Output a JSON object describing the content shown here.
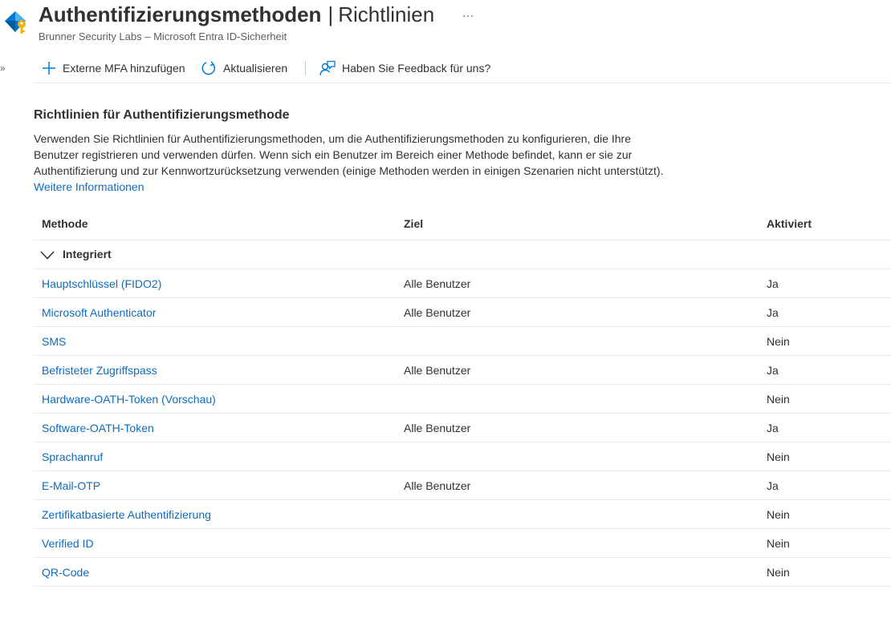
{
  "header": {
    "title": "Authentifizierungsmethoden",
    "title_separator": "|",
    "title_suffix": "Richtlinien",
    "more_icon": "…",
    "subtitle": "Brunner Security Labs – Microsoft Entra ID-Sicherheit"
  },
  "nav": {
    "collapse_icon": "»"
  },
  "toolbar": {
    "add_mfa_label": "Externe MFA hinzufügen",
    "refresh_label": "Aktualisieren",
    "feedback_label": "Haben Sie Feedback für uns?"
  },
  "section": {
    "title": "Richtlinien für Authentifizierungsmethode",
    "description": "Verwenden Sie Richtlinien für Authentifizierungsmethoden, um die Authentifizierungsmethoden zu konfigurieren, die Ihre Benutzer registrieren und verwenden dürfen. Wenn sich ein Benutzer im Bereich einer Methode befindet, kann er sie zur Authentifizierung und zur Kennwortzurücksetzung verwenden (einige Methoden werden in einigen Szenarien nicht unterstützt).",
    "learn_more": "Weitere Informationen"
  },
  "table": {
    "columns": [
      "Methode",
      "Ziel",
      "Aktiviert"
    ],
    "group_label": "Integriert",
    "rows": [
      {
        "method": "Hauptschlüssel (FIDO2)",
        "target": "Alle Benutzer",
        "enabled": "Ja"
      },
      {
        "method": "Microsoft Authenticator",
        "target": "Alle Benutzer",
        "enabled": "Ja"
      },
      {
        "method": "SMS",
        "target": "",
        "enabled": "Nein"
      },
      {
        "method": "Befristeter Zugriffspass",
        "target": "Alle Benutzer",
        "enabled": "Ja"
      },
      {
        "method": "Hardware-OATH-Token (Vorschau)",
        "target": "",
        "enabled": "Nein"
      },
      {
        "method": "Software-OATH-Token",
        "target": "Alle Benutzer",
        "enabled": "Ja"
      },
      {
        "method": "Sprachanruf",
        "target": "",
        "enabled": "Nein"
      },
      {
        "method": "E-Mail-OTP",
        "target": "Alle Benutzer",
        "enabled": "Ja"
      },
      {
        "method": "Zertifikatbasierte Authentifizierung",
        "target": "",
        "enabled": "Nein"
      },
      {
        "method": "Verified ID",
        "target": "",
        "enabled": "Nein"
      },
      {
        "method": "QR-Code",
        "target": "",
        "enabled": "Nein"
      }
    ]
  },
  "colors": {
    "link": "#0f6cbd",
    "text": "#323130",
    "secondary_text": "#605e5c",
    "divider": "#edebe9",
    "icon_accent": "#0078d4"
  }
}
